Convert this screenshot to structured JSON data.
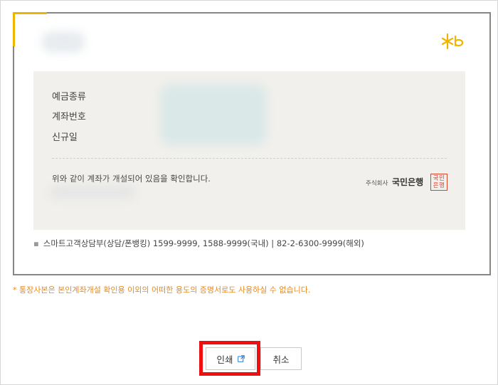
{
  "panel": {
    "labels": {
      "deposit_type": "예금종류",
      "account_number": "계좌번호",
      "opened_date": "신규일"
    },
    "confirm_text": "위와 같이 계좌가 개설되어 있음을 확인합니다.",
    "corp_prefix": "주식회사",
    "corp_name": "국민은행",
    "seal_line1": "국민",
    "seal_line2": "은행"
  },
  "contact": "스마트고객상담부(상담/폰뱅킹) 1599-9999, 1588-9999(국내) | 82-2-6300-9999(해외)",
  "notice": "* 통장사본은 본인계좌개설 확인용 이외의 어떠한 용도의 증명서로도 사용하실 수 없습니다.",
  "buttons": {
    "print": "인쇄",
    "cancel": "취소"
  },
  "colors": {
    "accent_yellow": "#f0b400",
    "notice_orange": "#e58a1f",
    "highlight_red": "#ee1010",
    "seal_red": "#d6452f",
    "panel_bg": "#f1f0ec"
  },
  "icons": {
    "brand": "kb-logo",
    "print_external": "external-link-icon"
  }
}
